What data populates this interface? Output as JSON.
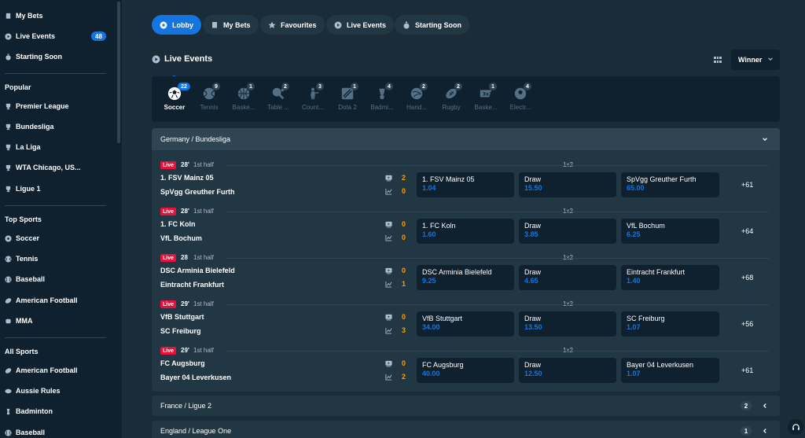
{
  "sidebar": {
    "top_items": [
      {
        "label": "My Bets",
        "icon": "receipt-icon"
      },
      {
        "label": "Live Events",
        "icon": "play-icon",
        "badge": "48"
      },
      {
        "label": "Starting Soon",
        "icon": "stopwatch-icon"
      }
    ],
    "popular_heading": "Popular",
    "popular": [
      {
        "label": "Premier League",
        "icon": "trophy-icon"
      },
      {
        "label": "Bundesliga",
        "icon": "trophy-icon"
      },
      {
        "label": "La Liga",
        "icon": "trophy-icon"
      },
      {
        "label": "WTA Chicago, US...",
        "icon": "trophy-icon"
      },
      {
        "label": "Ligue 1",
        "icon": "trophy-icon"
      }
    ],
    "top_sports_heading": "Top Sports",
    "top_sports": [
      {
        "label": "Soccer",
        "icon": "soccer-icon"
      },
      {
        "label": "Tennis",
        "icon": "tennis-icon"
      },
      {
        "label": "Baseball",
        "icon": "baseball-icon"
      },
      {
        "label": "American Football",
        "icon": "american-football-icon"
      },
      {
        "label": "MMA",
        "icon": "mma-icon"
      }
    ],
    "all_sports_heading": "All Sports",
    "all_sports": [
      {
        "label": "American Football",
        "icon": "american-football-icon"
      },
      {
        "label": "Aussie Rules",
        "icon": "aussie-rules-icon"
      },
      {
        "label": "Badminton",
        "icon": "badminton-icon"
      },
      {
        "label": "Baseball",
        "icon": "baseball-icon"
      }
    ]
  },
  "nav": {
    "tabs": [
      {
        "label": "Lobby",
        "icon": "lobby-icon",
        "active": true
      },
      {
        "label": "My Bets",
        "icon": "receipt-icon",
        "active": false
      },
      {
        "label": "Favourites",
        "icon": "star-icon",
        "active": false
      },
      {
        "label": "Live Events",
        "icon": "play-icon",
        "active": false
      },
      {
        "label": "Starting Soon",
        "icon": "stopwatch-icon",
        "active": false
      }
    ]
  },
  "section": {
    "title": "Live Events",
    "market_select": "Winner"
  },
  "sports_strip": [
    {
      "label": "Soccer",
      "count": "22",
      "icon": "soccer-icon",
      "active": true
    },
    {
      "label": "Tennis",
      "count": "9",
      "icon": "tennis-icon"
    },
    {
      "label": "Baske...",
      "count": "1",
      "icon": "basketball-icon"
    },
    {
      "label": "Table ...",
      "count": "2",
      "icon": "table-tennis-icon"
    },
    {
      "label": "Count...",
      "count": "3",
      "icon": "counter-strike-icon"
    },
    {
      "label": "Dota 2",
      "count": "1",
      "icon": "dota-icon"
    },
    {
      "label": "Badmi...",
      "count": "4",
      "icon": "badminton-icon"
    },
    {
      "label": "Hand...",
      "count": "2",
      "icon": "handball-icon"
    },
    {
      "label": "Rugby",
      "count": "2",
      "icon": "rugby-icon"
    },
    {
      "label": "Baske...",
      "count": "1",
      "icon": "basketball-3x3-icon"
    },
    {
      "label": "Electr...",
      "count": "4",
      "icon": "esoccer-icon"
    }
  ],
  "league": {
    "name": "Germany / Bundesliga",
    "matches": [
      {
        "live": "Live",
        "minute": "28'",
        "period": "1st half",
        "market": "1x2",
        "home": "1. FSV Mainz 05",
        "away": "SpVgg Greuther Furth",
        "home_score": "2",
        "away_score": "0",
        "odds": [
          {
            "name": "1. FSV Mainz 05",
            "value": "1.04"
          },
          {
            "name": "Draw",
            "value": "15.50"
          },
          {
            "name": "SpVgg Greuther Furth",
            "value": "65.00"
          }
        ],
        "more": "+61"
      },
      {
        "live": "Live",
        "minute": "28'",
        "period": "1st half",
        "market": "1x2",
        "home": "1. FC Koln",
        "away": "VfL Bochum",
        "home_score": "0",
        "away_score": "0",
        "odds": [
          {
            "name": "1. FC Koln",
            "value": "1.60"
          },
          {
            "name": "Draw",
            "value": "3.85"
          },
          {
            "name": "VfL Bochum",
            "value": "6.25"
          }
        ],
        "more": "+64"
      },
      {
        "live": "Live",
        "minute": "28",
        "period": "1st half",
        "market": "1x2",
        "home": "DSC Arminia Bielefeld",
        "away": "Eintracht Frankfurt",
        "home_score": "0",
        "away_score": "1",
        "odds": [
          {
            "name": "DSC Arminia Bielefeld",
            "value": "9.25"
          },
          {
            "name": "Draw",
            "value": "4.65"
          },
          {
            "name": "Eintracht Frankfurt",
            "value": "1.40"
          }
        ],
        "more": "+68"
      },
      {
        "live": "Live",
        "minute": "29'",
        "period": "1st half",
        "market": "1x2",
        "home": "VfB Stuttgart",
        "away": "SC Freiburg",
        "home_score": "0",
        "away_score": "3",
        "odds": [
          {
            "name": "VfB Stuttgart",
            "value": "34.00"
          },
          {
            "name": "Draw",
            "value": "13.50"
          },
          {
            "name": "SC Freiburg",
            "value": "1.07"
          }
        ],
        "more": "+56"
      },
      {
        "live": "Live",
        "minute": "29'",
        "period": "1st half",
        "market": "1x2",
        "home": "FC Augsburg",
        "away": "Bayer 04 Leverkusen",
        "home_score": "0",
        "away_score": "2",
        "odds": [
          {
            "name": "FC Augsburg",
            "value": "40.00"
          },
          {
            "name": "Draw",
            "value": "12.50"
          },
          {
            "name": "Bayer 04 Leverkusen",
            "value": "1.07"
          }
        ],
        "more": "+61"
      }
    ]
  },
  "collapsed_leagues": [
    {
      "name": "France / Ligue 2",
      "count": "2"
    },
    {
      "name": "England / League One",
      "count": "1"
    }
  ],
  "colors": {
    "background": "#1a2c38",
    "sidebar": "#0f212e",
    "panel": "#213743",
    "accent": "#1475e1",
    "live": "#e9113c",
    "score": "#ff9d00"
  }
}
